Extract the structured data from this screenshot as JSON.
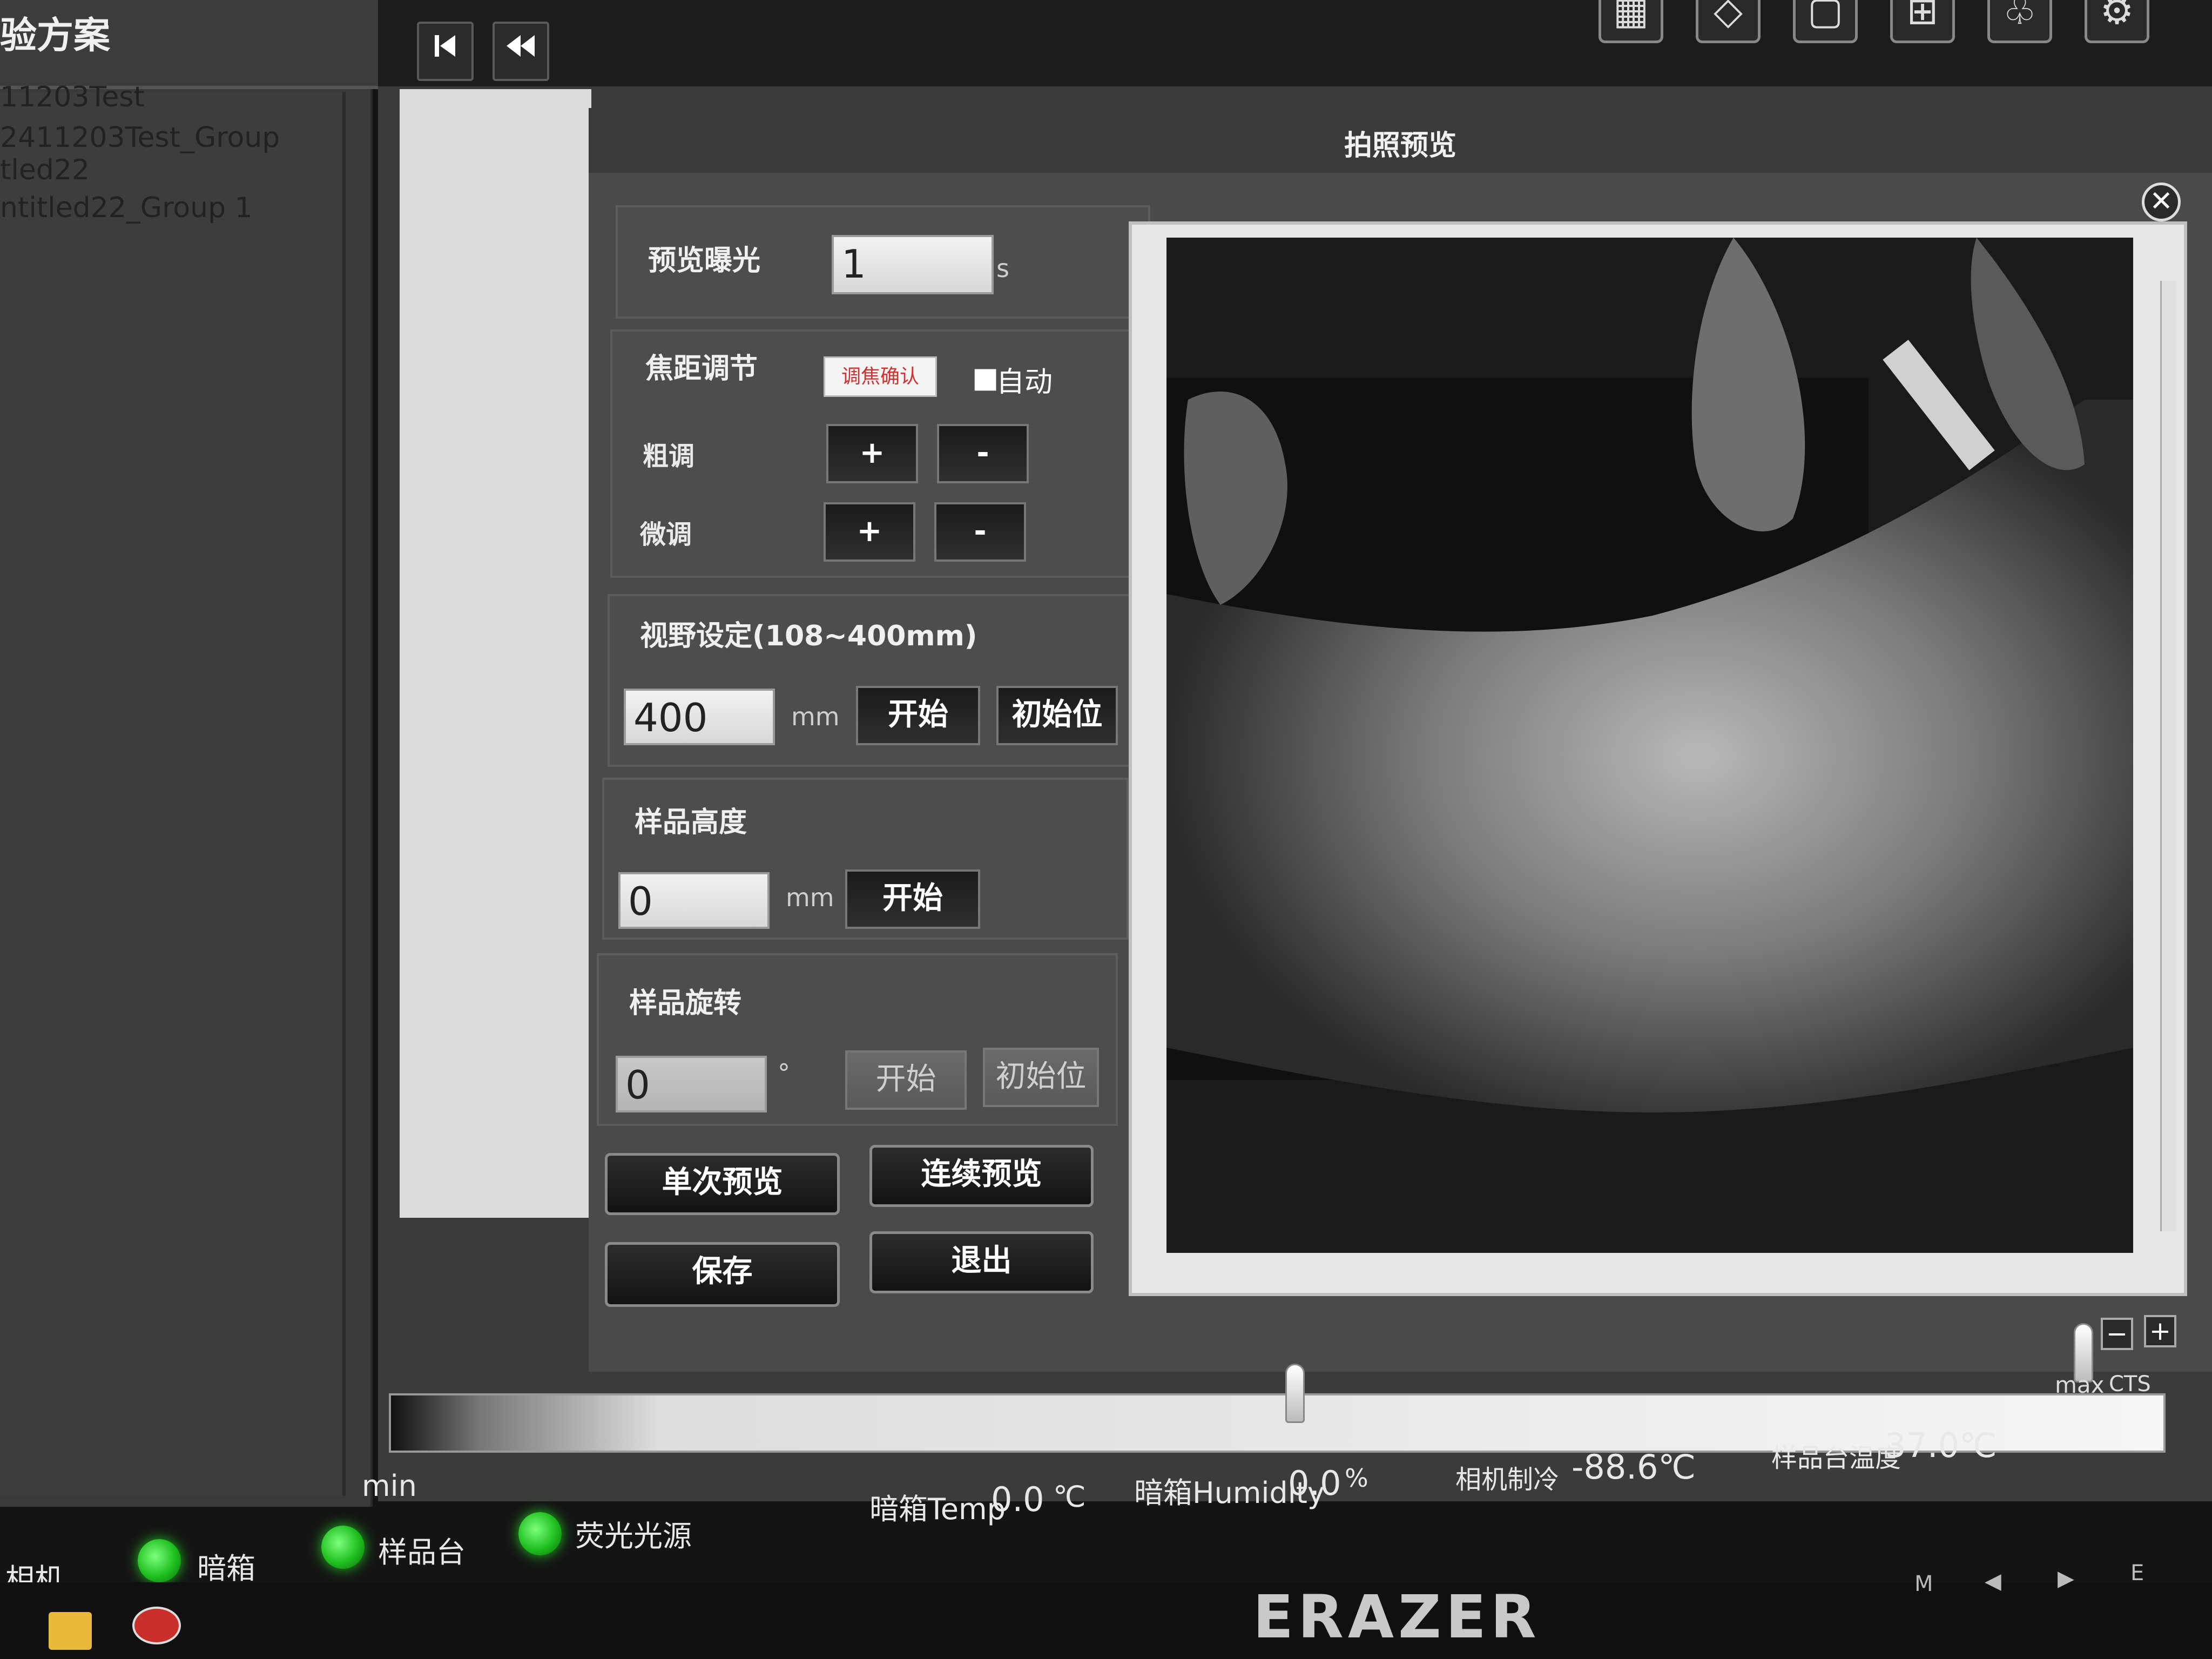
{
  "sidebar": {
    "title": "验方案",
    "items": [
      "11203Test",
      "2411203Test_Group",
      "tled22",
      "ntitled22_Group 1"
    ]
  },
  "toolbar": {
    "first_icon": "skip-to-start-icon",
    "prev_icon": "rewind-icon",
    "settings_icon": "gear-icon"
  },
  "dialog": {
    "title": "拍照预览",
    "close": "✕"
  },
  "exposure": {
    "label": "预览曝光",
    "value": "1",
    "unit": "s"
  },
  "focus": {
    "label": "焦距调节",
    "confirm": "调焦确认",
    "auto_checkbox": "■",
    "auto": "自动",
    "coarse": "粗调",
    "fine": "微调",
    "plus": "+",
    "minus": "-"
  },
  "fov": {
    "label": "视野设定(108~400mm)",
    "value": "400",
    "unit": "mm",
    "start": "开始",
    "home": "初始位"
  },
  "height": {
    "label": "样品高度",
    "value": "0",
    "unit": "mm",
    "start": "开始"
  },
  "rotation": {
    "label": "样品旋转",
    "value": "0",
    "unit": "°",
    "start": "开始",
    "home": "初始位"
  },
  "actions": {
    "single": "单次预览",
    "continuous": "连续预览",
    "save": "保存",
    "exit": "退出"
  },
  "histogram": {
    "min_label": "min",
    "max_label": "max",
    "unit_label": "CTS",
    "minus": "−",
    "plus": "+"
  },
  "sensors": [
    {
      "label": "暗箱Temp",
      "value": "0.0",
      "unit": "℃"
    },
    {
      "label": "暗箱Humidity",
      "value": "0.0",
      "unit": "%"
    },
    {
      "label": "相机制冷",
      "value": "-88.6℃"
    },
    {
      "label": "样品台温度",
      "value": "37.0℃"
    }
  ],
  "status": {
    "camera": "相机",
    "dark_box": "暗箱",
    "stage": "样品台",
    "fluor": "荧光光源",
    "led_color": "#22c322"
  },
  "monitor": {
    "brand": "ERAZER",
    "buttons": [
      "M",
      "◀",
      "▶",
      "E"
    ]
  }
}
